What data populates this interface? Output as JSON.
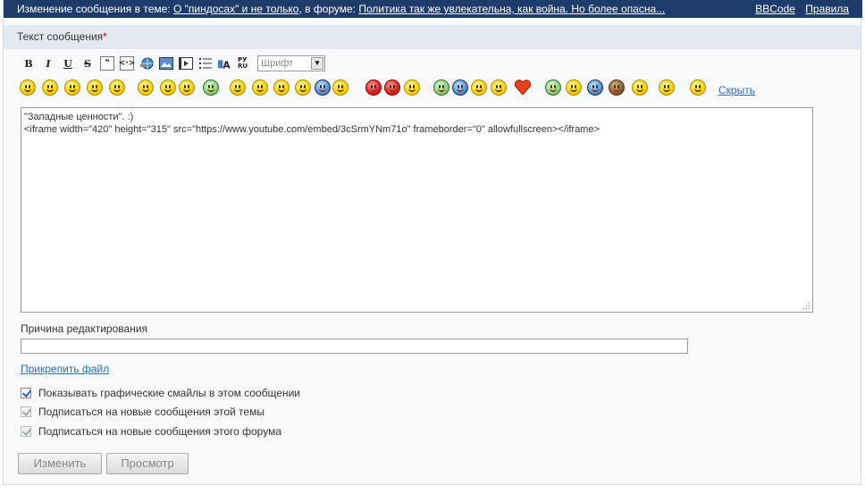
{
  "topbar": {
    "prefix": "Изменение сообщения в теме: ",
    "topic_link": "О \"пиндосах\" и не только",
    "middle": ", в форуме: ",
    "forum_link": "Политика так же увлекательна, как война. Но более опасна...",
    "bbcode_link": "BBCode",
    "rules_link": "Правила"
  },
  "section": {
    "title": "Текст сообщения",
    "required_mark": "*"
  },
  "toolbar": {
    "bold": "B",
    "italic": "I",
    "underline": "U",
    "strike": "S",
    "translit": "РУ RU",
    "font_placeholder": "Шрифт",
    "color_accent": "#1d3c6b"
  },
  "smileys": {
    "hide_label": "Скрыть",
    "count": 36
  },
  "editor": {
    "content_line1": "\"Западные ценности\". :)",
    "content_line2": "<iframe width=\"420\" height=\"315\" src=\"https://www.youtube.com/embed/3cSrmYNm71o\" frameborder=\"0\" allowfullscreen></iframe>"
  },
  "form": {
    "reason_label": "Причина редактирования",
    "reason_value": "",
    "attach_label": "Прикрепить файл",
    "options": [
      {
        "label": "Показывать графические смайлы в этом сообщении",
        "checked": true,
        "disabled": false
      },
      {
        "label": "Подписаться на новые сообщения этой темы",
        "checked": true,
        "disabled": true
      },
      {
        "label": "Подписаться на новые сообщения этого форума",
        "checked": true,
        "disabled": true
      }
    ],
    "submit_label": "Изменить",
    "preview_label": "Просмотр"
  }
}
